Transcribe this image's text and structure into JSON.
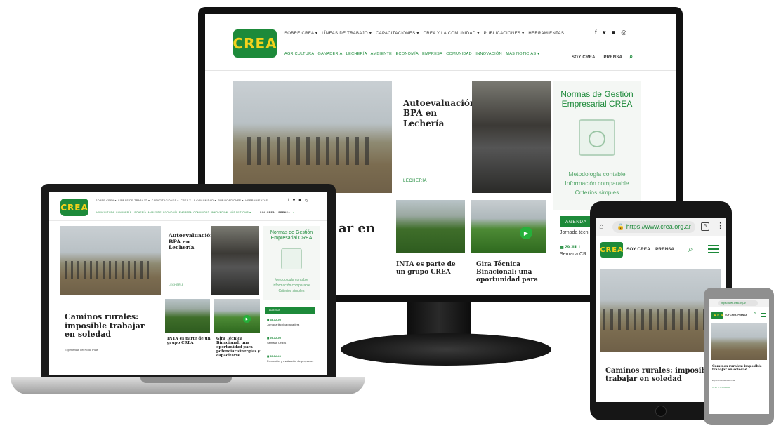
{
  "site": {
    "logo_text": "CREA",
    "top_nav": [
      "SOBRE CREA",
      "LÍNEAS DE TRABAJO",
      "CAPACITACIONES",
      "CREA Y LA COMUNIDAD",
      "PUBLICACIONES",
      "HERRAMIENTAS"
    ],
    "sub_nav": [
      "AGRICULTURA",
      "GANADERÍA",
      "LECHERÍA",
      "AMBIENTE",
      "ECONOMÍA",
      "EMPRESA",
      "COMUNIDAD",
      "INNOVACIÓN",
      "MÁS NOTICIAS"
    ],
    "soy_crea": "SOY CREA",
    "prensa": "PRENSA"
  },
  "articles": {
    "autoevaluacion": {
      "title": "Autoevaluación BPA en Lechería",
      "tag": "LECHERÍA"
    },
    "norms": {
      "title": "Normas de Gestión Empresarial CREA",
      "lines": [
        "Metodología contable",
        "Información comparable",
        "Criterios simples"
      ]
    },
    "caminos": {
      "title": "Caminos rurales: imposible trabajar en soledad",
      "caption": "Experiencia del Nodo Pilar"
    },
    "inta": {
      "title": "INTA es parte de un grupo CREA"
    },
    "gira": {
      "title": "Gira Técnica Binacional: una oportunidad para potenciar sinergias y capacitarse",
      "title_short": "Gira Técnica Binacional: una oportunidad para"
    },
    "partial_en": "ar en"
  },
  "agenda": {
    "label": "AGENDA",
    "items": [
      {
        "date": "28 JULIO",
        "text": "Jornada técnica ganadera"
      },
      {
        "date": "29 JULIO",
        "text": "Semana CREA"
      },
      {
        "date": "30 JULIO",
        "text": "Formación y evaluación de proyectos"
      }
    ],
    "partial": [
      {
        "date": "28 JULI",
        "text": "Jornada técni"
      },
      {
        "date": "29 JULI",
        "text": "Semana CR"
      }
    ]
  },
  "tablet": {
    "url": "https://www.crea.org.ar",
    "tabs_count": "5"
  },
  "phone": {
    "url": "https://www.crea.org.ar",
    "caption": "Experiencia del Nodo Pilar",
    "tag": "INSTITUCIONAL"
  },
  "colors": {
    "brand_green": "#1d8a3a",
    "logo_yellow": "#f3d21c"
  }
}
